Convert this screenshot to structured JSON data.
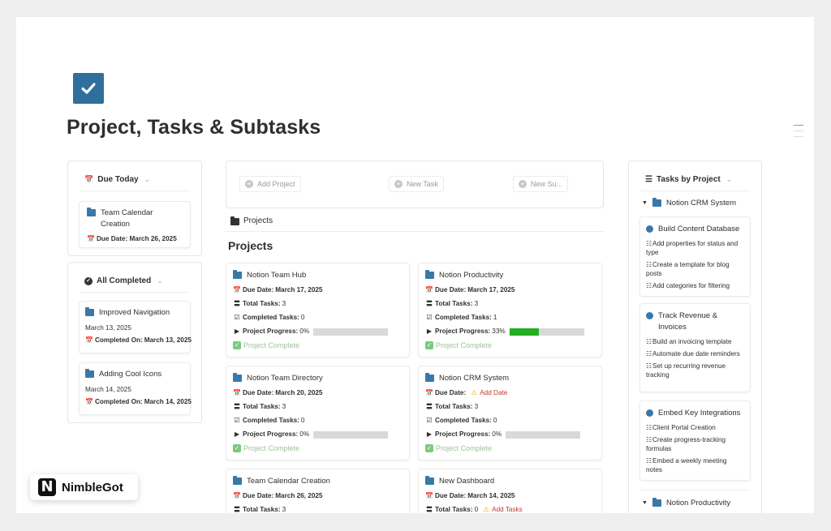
{
  "page": {
    "title": "Project, Tasks & Subtasks"
  },
  "left": {
    "due_today": {
      "tab_label": "Due Today",
      "cards": [
        {
          "title": "Team Calendar Creation",
          "due": "Due Date: March 26, 2025"
        }
      ]
    },
    "all_completed": {
      "tab_label": "All Completed",
      "cards": [
        {
          "title": "Improved Navigation",
          "date": "March 13, 2025",
          "completed_label": "Completed On:",
          "completed": "March 13, 2025"
        },
        {
          "title": "Adding Cool Icons",
          "date": "March 14, 2025",
          "completed_label": "Completed On:",
          "completed": "March 14, 2025"
        }
      ]
    }
  },
  "center": {
    "buttons": {
      "add_project": "Add Project",
      "new_task": "New Task",
      "new_subtask": "New Su..."
    },
    "db_tab_label": "Projects",
    "heading": "Projects",
    "labels": {
      "due_date": "Due Date:",
      "total_tasks": "Total Tasks:",
      "completed_tasks": "Completed Tasks:",
      "project_progress": "Project Progress:",
      "project_complete": "Project Complete",
      "add_date": "Add Date",
      "add_tasks": "Add Tasks"
    },
    "projects": [
      {
        "title": "Notion Team Hub",
        "due": "March 17, 2025",
        "total": "3",
        "completed": "0",
        "progress": "0%",
        "progress_value": 0
      },
      {
        "title": "Notion Productivity",
        "due": "March 17, 2025",
        "total": "3",
        "completed": "1",
        "progress": "33%",
        "progress_value": 0.4
      },
      {
        "title": "Notion Team Directory",
        "due": "March 20, 2025",
        "total": "3",
        "completed": "0",
        "progress": "0%",
        "progress_value": 0
      },
      {
        "title": "Notion CRM System",
        "due": "",
        "total": "3",
        "completed": "0",
        "progress": "0%",
        "progress_value": 0
      },
      {
        "title": "Team Calendar Creation",
        "due": "March 26, 2025",
        "total": "3"
      },
      {
        "title": "New Dashboard",
        "due": "March 14, 2025",
        "total": "0"
      }
    ]
  },
  "right": {
    "tab_label": "Tasks by Project",
    "groups": [
      {
        "name": "Notion CRM System",
        "tasks": [
          {
            "title": "Build Content Database",
            "subtasks": [
              "Add properties for status and type",
              "Create a template for blog posts",
              "Add categories for filtering"
            ]
          },
          {
            "title": "Track Revenue & Invoices",
            "subtasks": [
              "Build an invoicing template",
              "Automate due date reminders",
              "Set up recurring revenue tracking"
            ]
          },
          {
            "title": "Embed Key Integrations",
            "subtasks": [
              "Client Portal Creation",
              "Create progress-tracking formulas",
              "Embed a weekly meeting notes"
            ]
          }
        ]
      },
      {
        "name": "Notion Productivity",
        "tasks": []
      }
    ]
  },
  "brand": {
    "name": "NimbleGot",
    "logo_letter": "N"
  },
  "colors": {
    "accent_blue": "#2f6f9c",
    "progress_green": "#22b022",
    "warning_red": "#c0392b"
  }
}
